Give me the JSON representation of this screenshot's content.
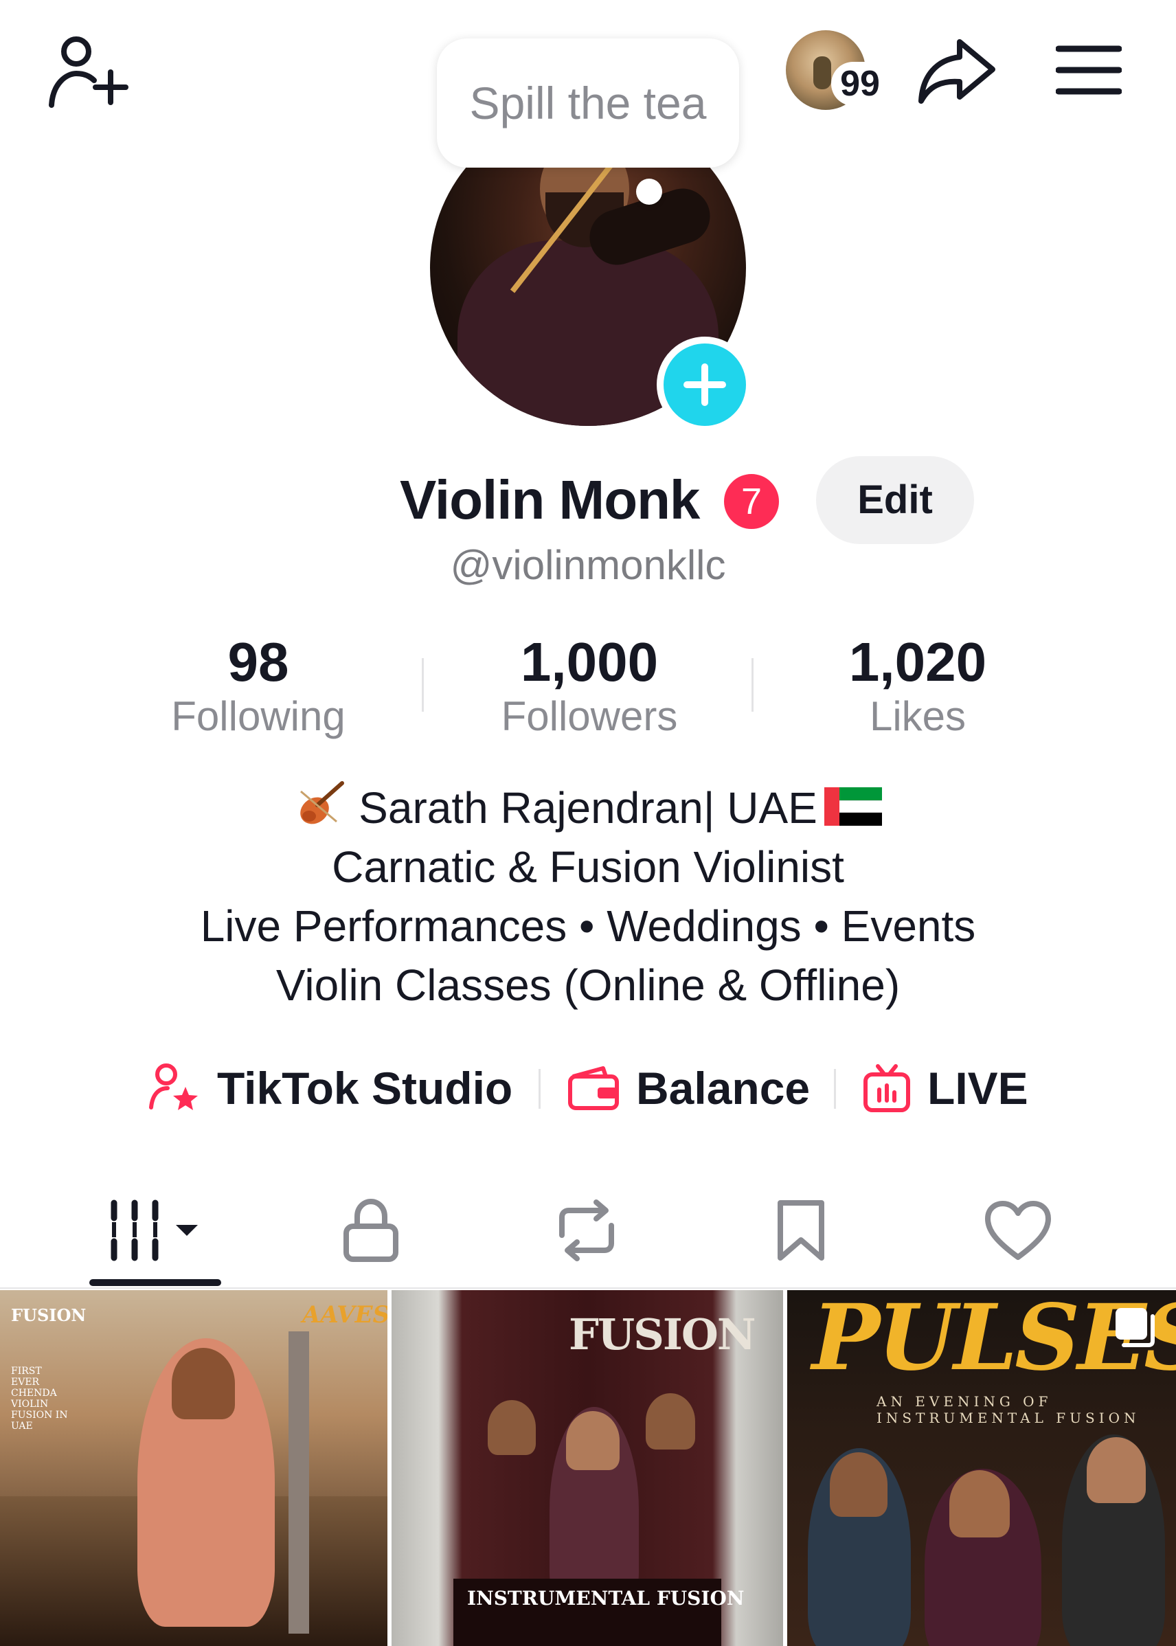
{
  "header": {
    "bubble_text": "Spill the tea",
    "notification_count": "99"
  },
  "profile": {
    "name": "Violin Monk",
    "name_badge": "7",
    "edit_label": "Edit",
    "handle": "@violinmonkllc"
  },
  "stats": [
    {
      "value": "98",
      "label": "Following"
    },
    {
      "value": "1,000",
      "label": "Followers"
    },
    {
      "value": "1,020",
      "label": "Likes"
    }
  ],
  "bio": {
    "line1": "Sarath  Rajendran| UAE",
    "line2": "Carnatic & Fusion Violinist",
    "line3": "Live Performances • Weddings • Events",
    "line4": "Violin Classes (Online & Offline)"
  },
  "links": [
    {
      "label": "TikTok Studio",
      "icon": "creator-star-icon"
    },
    {
      "label": "Balance",
      "icon": "wallet-icon"
    },
    {
      "label": "LIVE",
      "icon": "live-tv-icon"
    }
  ],
  "tabs": [
    {
      "icon": "videos-grid-icon",
      "selected": true
    },
    {
      "icon": "lock-icon",
      "selected": false
    },
    {
      "icon": "repost-icon",
      "selected": false
    },
    {
      "icon": "bookmark-icon",
      "selected": false
    },
    {
      "icon": "heart-icon",
      "selected": false
    }
  ],
  "videos": [
    {
      "brand": "FUSION",
      "team": "AAVESHAM",
      "side_text": "FIRST EVER CHENDA VIOLIN FUSION IN UAE"
    },
    {
      "brand": "FUSION",
      "footer": "INSTRUMENTAL FUSION"
    },
    {
      "title": "PULSES",
      "subtitle": "AN EVENING OF INSTRUMENTAL FUSION"
    }
  ],
  "colors": {
    "accent_red": "#fe2c55",
    "accent_cyan": "#20d5ec",
    "text_primary": "#161823",
    "text_secondary": "#8a8b91"
  }
}
